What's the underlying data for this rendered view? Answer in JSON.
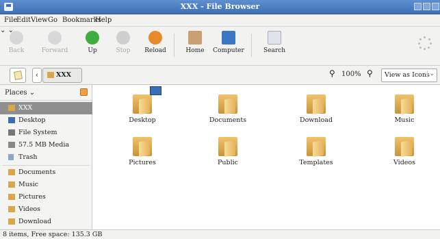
{
  "window": {
    "title": "XXX - File Browser"
  },
  "menubar": [
    "File",
    "Edit",
    "View",
    "Go",
    "Bookmarks",
    "Help"
  ],
  "toolbar": {
    "back": "Back",
    "forward": "Forward",
    "up": "Up",
    "stop": "Stop",
    "reload": "Reload",
    "home": "Home",
    "computer": "Computer",
    "search": "Search"
  },
  "locationbar": {
    "crumb": "XXX",
    "zoom": "100%",
    "view_mode": "View as Icons"
  },
  "sidebar": {
    "header": "Places",
    "items": [
      "XXX",
      "Desktop",
      "File System",
      "57.5 MB Media",
      "Trash"
    ],
    "bookmarks": [
      "Documents",
      "Music",
      "Pictures",
      "Videos",
      "Download"
    ]
  },
  "files": [
    "Desktop",
    "Documents",
    "Download",
    "Music",
    "Pictures",
    "Public",
    "Templates",
    "Videos"
  ],
  "status": "8 items, Free space: 135.3 GB",
  "colors": {
    "titlebar": "#4a7cc2",
    "selection": "#8f8f8f",
    "folder": "#d9a64e"
  }
}
